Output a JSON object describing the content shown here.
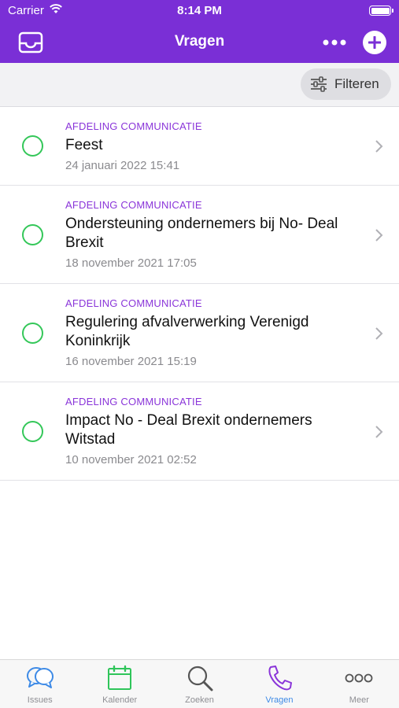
{
  "status_bar": {
    "carrier": "Carrier",
    "time": "8:14 PM"
  },
  "nav": {
    "title": "Vragen",
    "icons": {
      "left": "inbox-icon",
      "more": "more-dots-icon",
      "add": "plus-circle-icon"
    }
  },
  "filter": {
    "label": "Filteren",
    "icon": "sliders-icon"
  },
  "items": [
    {
      "dept": "AFDELING COMMUNICATIE",
      "title": "Feest",
      "date": "24 januari 2022 15:41"
    },
    {
      "dept": "AFDELING COMMUNICATIE",
      "title": "Ondersteuning ondernemers bij No- Deal Brexit",
      "date": "18 november 2021 17:05"
    },
    {
      "dept": "AFDELING COMMUNICATIE",
      "title": "Regulering afvalverwerking Verenigd Koninkrijk",
      "date": "16 november 2021 15:19"
    },
    {
      "dept": "AFDELING COMMUNICATIE",
      "title": "Impact No - Deal Brexit ondernemers Witstad",
      "date": "10 november 2021 02:52"
    }
  ],
  "tabs": [
    {
      "label": "Issues",
      "icon": "chat-bubbles-icon"
    },
    {
      "label": "Kalender",
      "icon": "calendar-icon"
    },
    {
      "label": "Zoeken",
      "icon": "search-icon"
    },
    {
      "label": "Vragen",
      "icon": "phone-icon",
      "active": true
    },
    {
      "label": "Meer",
      "icon": "more-circles-icon"
    }
  ],
  "colors": {
    "brand": "#7a2fd6",
    "status_open": "#34c759",
    "tab_active": "#3d8ae6"
  }
}
